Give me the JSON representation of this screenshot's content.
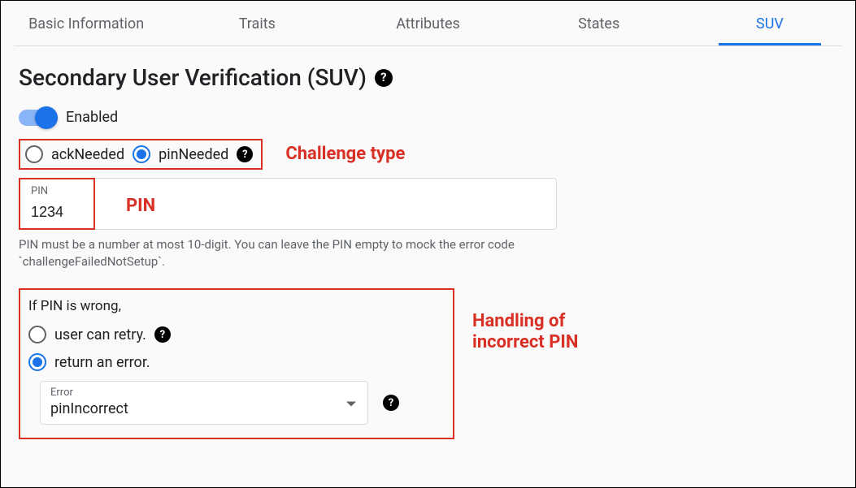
{
  "tabs": [
    {
      "label": "Basic Information",
      "active": false
    },
    {
      "label": "Traits",
      "active": false
    },
    {
      "label": "Attributes",
      "active": false
    },
    {
      "label": "States",
      "active": false
    },
    {
      "label": "SUV",
      "active": true
    }
  ],
  "page": {
    "title": "Secondary User Verification (SUV)"
  },
  "toggle": {
    "label": "Enabled",
    "on": true
  },
  "challenge": {
    "options": {
      "ack": "ackNeeded",
      "pin": "pinNeeded"
    },
    "selected": "pin"
  },
  "pinField": {
    "label": "PIN",
    "value": "1234",
    "hint": "PIN must be a number at most 10-digit. You can leave the PIN empty to mock the error code `challengeFailedNotSetup`."
  },
  "wrongPin": {
    "prompt": "If PIN is wrong,",
    "options": {
      "retry": "user can retry.",
      "error": "return an error."
    },
    "selected": "error",
    "errorSelect": {
      "label": "Error",
      "value": "pinIncorrect"
    }
  },
  "annotations": {
    "challenge": "Challenge type",
    "pin": "PIN",
    "handling_l1": "Handling of",
    "handling_l2": "incorrect PIN"
  }
}
